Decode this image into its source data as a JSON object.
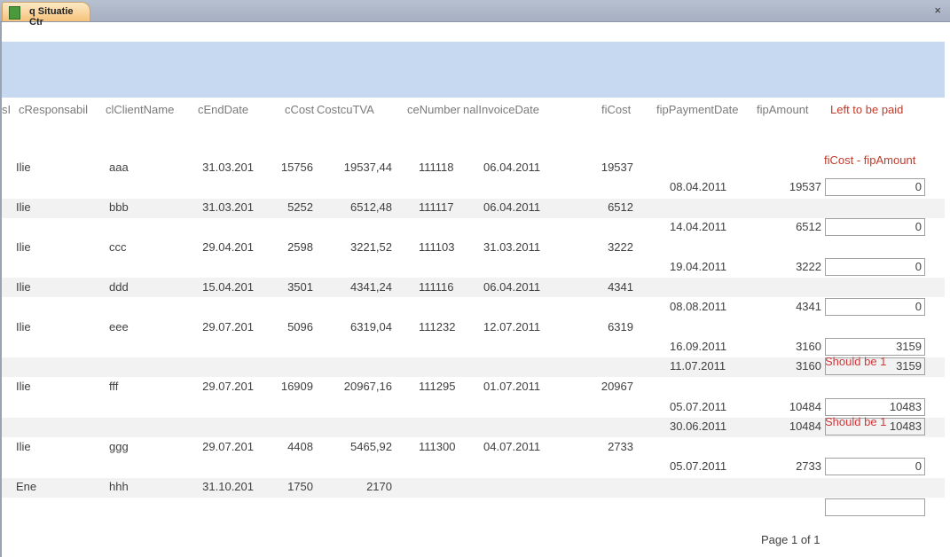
{
  "window": {
    "tab_title": "q Situatie Ctr",
    "close": "×"
  },
  "headers": {
    "c0": "sI",
    "resp": "cResponsabil",
    "client": "clClientName",
    "end": "cEndDate",
    "cost": "cCost",
    "tva": "CostcuTVA",
    "invnum": "ceNumber",
    "invdate": "nalInvoiceDate",
    "ficost": "fiCost",
    "paydate": "fipPaymentDate",
    "amount": "fipAmount",
    "left": "Left to be paid",
    "formula": "fiCost - fipAmount"
  },
  "contracts": [
    {
      "resp": "Ilie",
      "client": "aaa",
      "end": "31.03.201",
      "cost": "15756",
      "tva": "19537,44",
      "invnum": "111118",
      "invdate": "06.04.2011",
      "ficost": "19537"
    },
    {
      "resp": "Ilie",
      "client": "bbb",
      "end": "31.03.201",
      "cost": "5252",
      "tva": "6512,48",
      "invnum": "111117",
      "invdate": "06.04.2011",
      "ficost": "6512"
    },
    {
      "resp": "Ilie",
      "client": "ccc",
      "end": "29.04.201",
      "cost": "2598",
      "tva": "3221,52",
      "invnum": "111103",
      "invdate": "31.03.2011",
      "ficost": "3222"
    },
    {
      "resp": "Ilie",
      "client": "ddd",
      "end": "15.04.201",
      "cost": "3501",
      "tva": "4341,24",
      "invnum": "111116",
      "invdate": "06.04.2011",
      "ficost": "4341"
    },
    {
      "resp": "Ilie",
      "client": "eee",
      "end": "29.07.201",
      "cost": "5096",
      "tva": "6319,04",
      "invnum": "111232",
      "invdate": "12.07.2011",
      "ficost": "6319"
    },
    {
      "resp": "Ilie",
      "client": "fff",
      "end": "29.07.201",
      "cost": "16909",
      "tva": "20967,16",
      "invnum": "111295",
      "invdate": "01.07.2011",
      "ficost": "20967"
    },
    {
      "resp": "Ilie",
      "client": "ggg",
      "end": "29.07.201",
      "cost": "4408",
      "tva": "5465,92",
      "invnum": "111300",
      "invdate": "04.07.2011",
      "ficost": "2733"
    },
    {
      "resp": "Ene",
      "client": "hhh",
      "end": "31.10.201",
      "cost": "1750",
      "tva": "2170",
      "invnum": "",
      "invdate": "",
      "ficost": ""
    }
  ],
  "payments": [
    {
      "date": "08.04.2011",
      "amount": "19537",
      "left": "0",
      "note": ""
    },
    {
      "date": "14.04.2011",
      "amount": "6512",
      "left": "0",
      "note": ""
    },
    {
      "date": "19.04.2011",
      "amount": "3222",
      "left": "0",
      "note": ""
    },
    {
      "date": "08.08.2011",
      "amount": "4341",
      "left": "0",
      "note": ""
    },
    {
      "date": "16.09.2011",
      "amount": "3160",
      "left": "3159",
      "note": ""
    },
    {
      "date": "11.07.2011",
      "amount": "3160",
      "left": "3159",
      "note": "Should be 1"
    },
    {
      "date": "05.07.2011",
      "amount": "10484",
      "left": "10483",
      "note": ""
    },
    {
      "date": "30.06.2011",
      "amount": "10484",
      "left": "10483",
      "note": "Should be 1"
    },
    {
      "date": "05.07.2011",
      "amount": "2733",
      "left": "0",
      "note": ""
    },
    {
      "date": "",
      "amount": "",
      "left": "",
      "note": ""
    }
  ],
  "footer": {
    "page": "Page 1 of 1"
  }
}
